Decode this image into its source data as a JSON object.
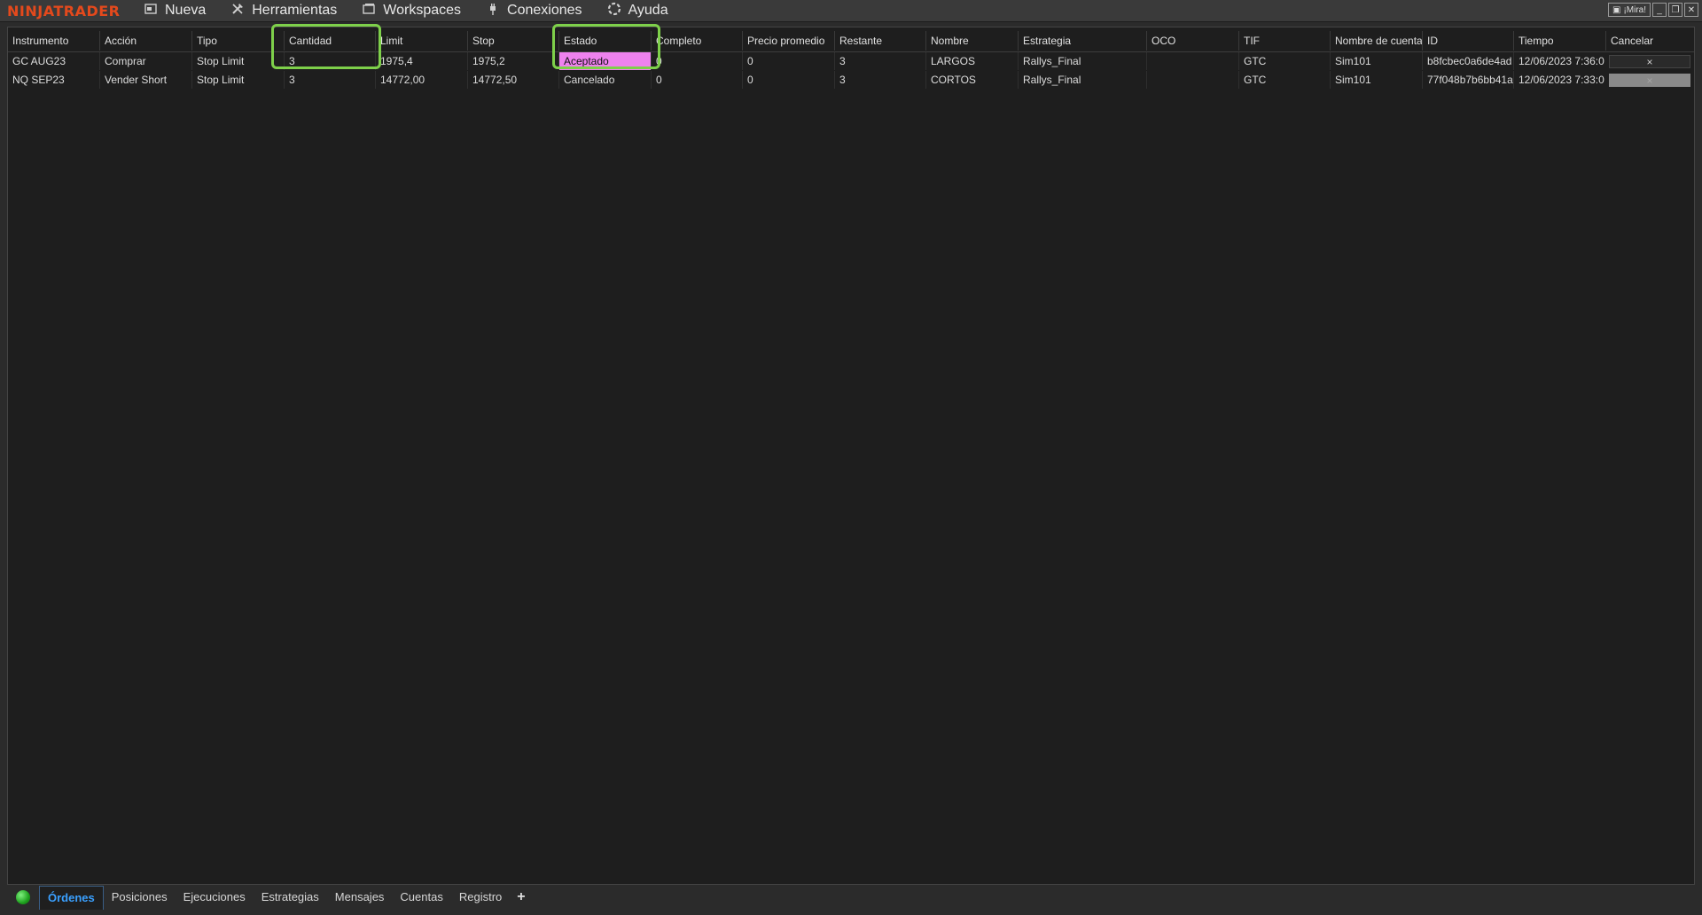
{
  "app": {
    "logo": "NINJATRADER",
    "menu": [
      {
        "label": "Nueva",
        "icon": "new-window-icon"
      },
      {
        "label": "Herramientas",
        "icon": "tools-icon"
      },
      {
        "label": "Workspaces",
        "icon": "workspaces-icon"
      },
      {
        "label": "Conexiones",
        "icon": "plug-icon"
      },
      {
        "label": "Ayuda",
        "icon": "help-lifebuoy-icon"
      }
    ],
    "window": {
      "mira_label": "¡Mira!"
    }
  },
  "grid": {
    "columns": [
      "Instrumento",
      "Acción",
      "Tipo",
      "Cantidad",
      "Limit",
      "Stop",
      "Estado",
      "Completo",
      "Precio promedio",
      "Restante",
      "Nombre",
      "Estrategia",
      "OCO",
      "TIF",
      "Nombre de cuenta",
      "ID",
      "Tiempo",
      "Cancelar"
    ],
    "rows": [
      {
        "instrumento": "GC AUG23",
        "accion": "Comprar",
        "tipo": "Stop Limit",
        "cantidad": "3",
        "limit": "1975,4",
        "stop": "1975,2",
        "estado": "Aceptado",
        "completo": "0",
        "precio_promedio": "0",
        "restante": "3",
        "nombre": "LARGOS",
        "estrategia": "Rallys_Final",
        "oco": "",
        "tif": "GTC",
        "cuenta": "Sim101",
        "id": "b8fcbec0a6de4ad",
        "tiempo": "12/06/2023 7:36:0",
        "cancelar": "×",
        "cancel_enabled": true
      },
      {
        "instrumento": "NQ SEP23",
        "accion": "Vender Short",
        "tipo": "Stop Limit",
        "cantidad": "3",
        "limit": "14772,00",
        "stop": "14772,50",
        "estado": "Cancelado",
        "completo": "0",
        "precio_promedio": "0",
        "restante": "3",
        "nombre": "CORTOS",
        "estrategia": "Rallys_Final",
        "oco": "",
        "tif": "GTC",
        "cuenta": "Sim101",
        "id": "77f048b7b6bb41a",
        "tiempo": "12/06/2023 7:33:0",
        "cancelar": "×",
        "cancel_enabled": false
      }
    ]
  },
  "tabs": {
    "items": [
      "Órdenes",
      "Posiciones",
      "Ejecuciones",
      "Estrategias",
      "Mensajes",
      "Cuentas",
      "Registro"
    ],
    "active": "Órdenes",
    "add_label": "+"
  },
  "colors": {
    "accent_logo": "#e4491c",
    "status_accepted": "#ee82ee",
    "highlight": "#7ed04a",
    "active_tab": "#3aa0ff"
  }
}
